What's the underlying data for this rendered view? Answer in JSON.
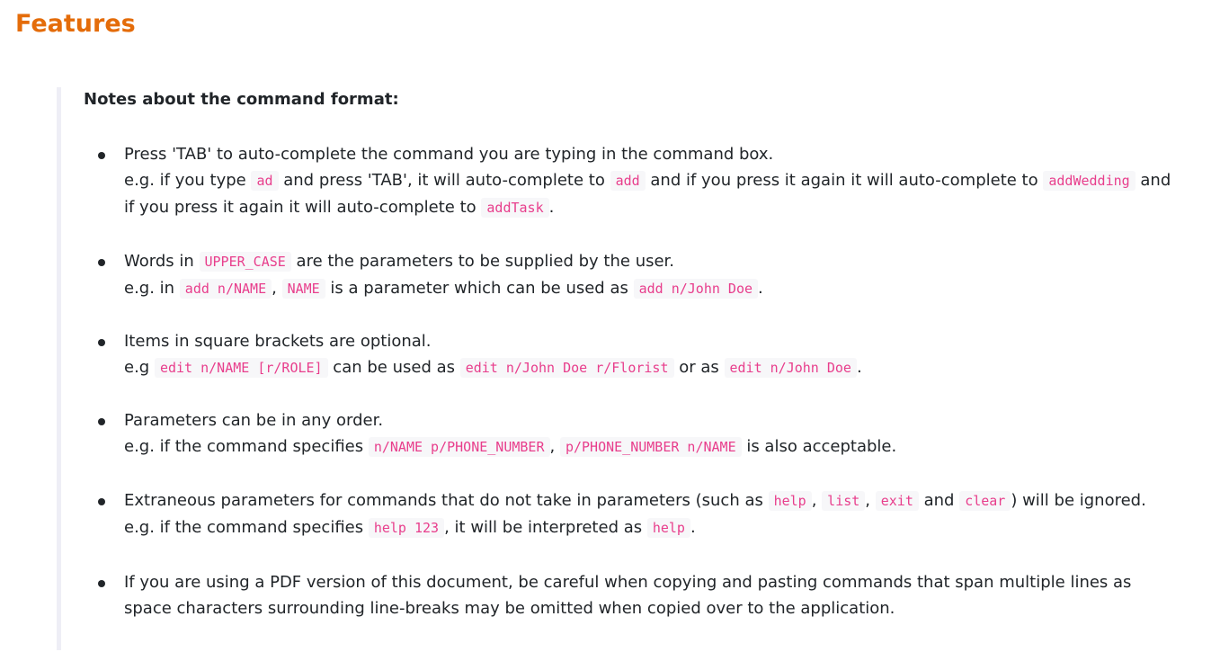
{
  "page": {
    "title": "Features"
  },
  "notes": {
    "heading": "Notes about the command format:",
    "items": [
      {
        "l1": "Press 'TAB' to auto-complete the command you are typing in the command box.",
        "l2_a": "e.g. if you type ",
        "c1": "ad",
        "l2_b": " and press 'TAB', it will auto-complete to ",
        "c2": "add",
        "l2_c": " and if you press it again it will auto-complete to ",
        "c3": "addWedding",
        "l2_d": " and if you press it again it will auto-complete to ",
        "c4": "addTask",
        "l2_e": "."
      },
      {
        "l1_a": "Words in ",
        "c1": "UPPER_CASE",
        "l1_b": " are the parameters to be supplied by the user.",
        "l2_a": "e.g. in ",
        "c2": "add n/NAME",
        "l2_b": ", ",
        "c3": "NAME",
        "l2_c": " is a parameter which can be used as ",
        "c4": "add n/John Doe",
        "l2_d": "."
      },
      {
        "l1": "Items in square brackets are optional.",
        "l2_a": "e.g ",
        "c1": "edit n/NAME [r/ROLE]",
        "l2_b": " can be used as ",
        "c2": "edit n/John Doe r/Florist",
        "l2_c": " or as ",
        "c3": "edit n/John Doe",
        "l2_d": "."
      },
      {
        "l1": "Parameters can be in any order.",
        "l2_a": "e.g. if the command specifies ",
        "c1": "n/NAME p/PHONE_NUMBER",
        "l2_b": ", ",
        "c2": "p/PHONE_NUMBER n/NAME",
        "l2_c": " is also acceptable."
      },
      {
        "l1_a": "Extraneous parameters for commands that do not take in parameters (such as ",
        "c1": "help",
        "l1_b": ", ",
        "c2": "list",
        "l1_c": ", ",
        "c3": "exit",
        "l1_d": " and ",
        "c4": "clear",
        "l1_e": ") will be ignored.",
        "l2_a": "e.g. if the command specifies ",
        "c5": "help 123",
        "l2_b": ", it will be interpreted as ",
        "c6": "help",
        "l2_c": "."
      },
      {
        "l1": "If you are using a PDF version of this document, be careful when copying and pasting commands that span multiple lines as space characters surrounding line-breaks may be omitted when copied over to the application."
      }
    ]
  }
}
